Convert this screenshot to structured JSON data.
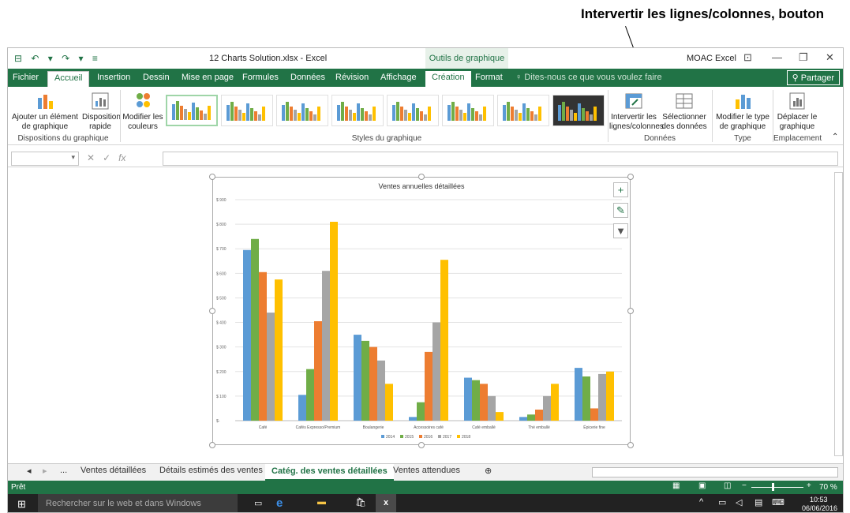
{
  "callout": {
    "text": "Intervertir les lignes/colonnes, bouton"
  },
  "titlebar": {
    "qat_label": "⊟ ↶ ▾ ↷ ▾ ≡",
    "doc_title": "12 Charts Solution.xlsx - Excel",
    "context_tab": "Outils de graphique",
    "user": "MOAC Excel"
  },
  "tabs": [
    "Fichier",
    "Accueil",
    "Insertion",
    "Dessin",
    "Mise en page",
    "Formules",
    "Données",
    "Révision",
    "Affichage",
    "Création",
    "Format"
  ],
  "tellme": "Dites-nous ce que vous voulez faire",
  "share": "Partager",
  "ribbon": {
    "add_element": "Ajouter un élément de graphique",
    "quick_layout": "Disposition rapide",
    "group_layouts": "Dispositions du graphique",
    "change_colors": "Modifier les couleurs",
    "group_styles": "Styles du graphique",
    "switch_rowcol": "Intervertir les lignes/colonnes",
    "select_data": "Sélectionner des données",
    "group_data": "Données",
    "change_type": "Modifier le type de graphique",
    "group_type": "Type",
    "move_chart": "Déplacer le graphique",
    "group_location": "Emplacement"
  },
  "formula": {
    "fx": "fx"
  },
  "sheet_tabs": [
    "...",
    "Ventes détaillées",
    "Détails estimés des ventes",
    "Catég. des ventes détaillées",
    "Ventes attendues"
  ],
  "status": {
    "ready": "Prêt",
    "zoom": "70 %"
  },
  "taskbar": {
    "search": "Rechercher sur le web et dans Windows",
    "time": "10:53",
    "date": "06/06/2016"
  },
  "chart_data": {
    "type": "bar",
    "title": "Ventes annuelles détaillées",
    "categories": [
      "Café",
      "Cafés Expresso/Premium",
      "Boulangerie",
      "Accessoires café",
      "Café emballé",
      "Thé emballé",
      "Épicerie fine"
    ],
    "series": [
      {
        "name": "2014",
        "color": "#5b9bd5",
        "values": [
          695,
          105,
          350,
          15,
          175,
          15,
          215
        ]
      },
      {
        "name": "2015",
        "color": "#70ad47",
        "values": [
          740,
          210,
          325,
          75,
          165,
          25,
          180
        ]
      },
      {
        "name": "2016",
        "color": "#ed7d31",
        "values": [
          605,
          405,
          300,
          280,
          150,
          45,
          50
        ]
      },
      {
        "name": "2017",
        "color": "#a5a5a5",
        "values": [
          440,
          610,
          245,
          400,
          100,
          100,
          190
        ]
      },
      {
        "name": "2018",
        "color": "#ffc000",
        "values": [
          575,
          810,
          150,
          655,
          35,
          150,
          200
        ]
      }
    ],
    "yticks": [
      "$ 900",
      "$ 800",
      "$ 700",
      "$ 600",
      "$ 500",
      "$ 400",
      "$ 300",
      "$ 200",
      "$ 100",
      "$-"
    ],
    "ylim": [
      0,
      900
    ],
    "legend": "bottom"
  }
}
